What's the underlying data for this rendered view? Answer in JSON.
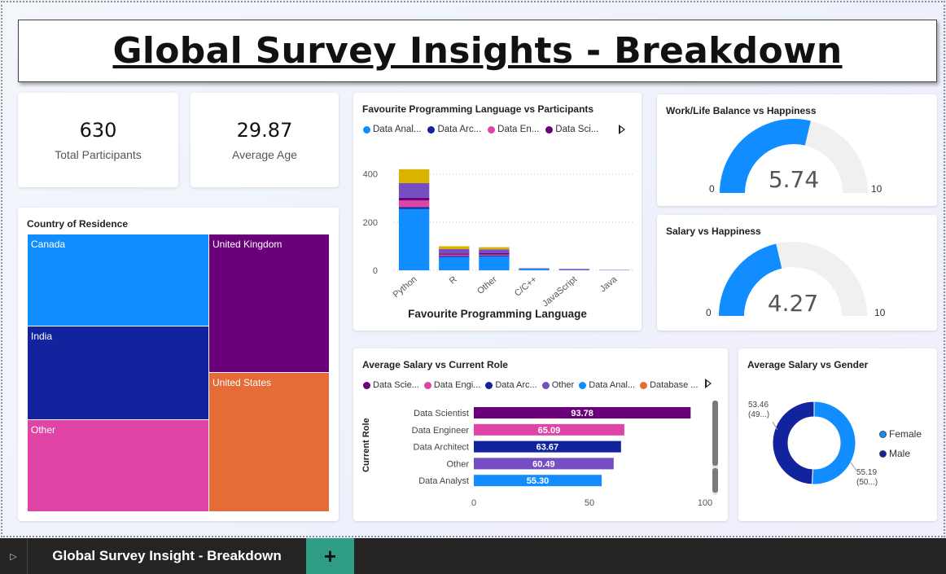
{
  "page": {
    "title": "Global Survey Insights - Breakdown"
  },
  "kpis": {
    "participants": {
      "value": "630",
      "label": "Total Participants"
    },
    "age": {
      "value": "29.87",
      "label": "Average Age"
    }
  },
  "treemap": {
    "title": "Country of Residence",
    "cells": [
      {
        "label": "Canada",
        "color": "#118dff"
      },
      {
        "label": "United Kingdom",
        "color": "#6b007b"
      },
      {
        "label": "India",
        "color": "#12239e"
      },
      {
        "label": "United States",
        "color": "#e66c37"
      },
      {
        "label": "Other",
        "color": "#e044a7"
      }
    ]
  },
  "lang_chart": {
    "title": "Favourite Programming Language vs Participants",
    "legend": [
      {
        "label": "Data Anal...",
        "color": "#118dff"
      },
      {
        "label": "Data Arc...",
        "color": "#12239e"
      },
      {
        "label": "Data En...",
        "color": "#e044a7"
      },
      {
        "label": "Data Sci...",
        "color": "#6b007b"
      }
    ],
    "xlabel": "Favourite Programming Language"
  },
  "role_chart": {
    "title": "Average Salary vs Current Role",
    "legend": [
      {
        "label": "Data Scie...",
        "color": "#6b007b"
      },
      {
        "label": "Data Engi...",
        "color": "#e044a7"
      },
      {
        "label": "Data Arc...",
        "color": "#12239e"
      },
      {
        "label": "Other",
        "color": "#744ec2"
      },
      {
        "label": "Data Anal...",
        "color": "#118dff"
      },
      {
        "label": "Database ...",
        "color": "#e66c37"
      }
    ],
    "ylabel": "Current Role"
  },
  "gauges": {
    "worklife": {
      "title": "Work/Life Balance vs Happiness",
      "value": 5.74,
      "value_text": "5.74",
      "min": "0",
      "max": "10"
    },
    "salary": {
      "title": "Salary vs Happiness",
      "value": 4.27,
      "value_text": "4.27",
      "min": "0",
      "max": "10"
    }
  },
  "donut": {
    "title": "Average Salary vs Gender",
    "legend": [
      {
        "label": "Female",
        "color": "#118dff"
      },
      {
        "label": "Male",
        "color": "#12239e"
      }
    ],
    "label_male": [
      "53.46",
      "(49...)"
    ],
    "label_female": [
      "55.19",
      "(50...)"
    ]
  },
  "tabs": {
    "active": "Global Survey Insight - Breakdown",
    "add": "+",
    "nav": "▷"
  },
  "chart_data": [
    {
      "type": "bar",
      "stacked": true,
      "categories": [
        "Python",
        "R",
        "Other",
        "C/C++",
        "JavaScript",
        "Java"
      ],
      "series": [
        {
          "name": "Data Anal...",
          "color": "#118dff",
          "values": [
            255,
            55,
            58,
            6,
            2,
            1
          ]
        },
        {
          "name": "Data Arc...",
          "color": "#12239e",
          "values": [
            8,
            5,
            4,
            1,
            1,
            0
          ]
        },
        {
          "name": "Data En...",
          "color": "#e044a7",
          "values": [
            27,
            5,
            4,
            1,
            2,
            0
          ]
        },
        {
          "name": "Data Sci...",
          "color": "#6b007b",
          "values": [
            12,
            5,
            5,
            0,
            0,
            0
          ]
        },
        {
          "color": "#744ec2",
          "values": [
            60,
            18,
            16,
            1,
            1,
            1
          ]
        },
        {
          "color": "#d9b300",
          "values": [
            58,
            12,
            9,
            0,
            0,
            0
          ]
        }
      ],
      "yticks": [
        0,
        200,
        400
      ],
      "ylim": [
        0,
        460
      ],
      "xlabel": "Favourite Programming Language"
    },
    {
      "type": "bar",
      "orientation": "horizontal",
      "categories": [
        "Data Scientist",
        "Data Engineer",
        "Data Architect",
        "Other",
        "Data Analyst"
      ],
      "values": [
        93.78,
        65.09,
        63.67,
        60.49,
        55.3
      ],
      "value_labels": [
        "93.78",
        "65.09",
        "63.67",
        "60.49",
        "55.30"
      ],
      "colors": [
        "#6b007b",
        "#e044a7",
        "#12239e",
        "#744ec2",
        "#118dff"
      ],
      "xticks": [
        0,
        50,
        100
      ],
      "xlim": [
        0,
        100
      ],
      "ylabel": "Current Role"
    },
    {
      "type": "pie",
      "donut": true,
      "labels": [
        "Female",
        "Male"
      ],
      "values": [
        55.19,
        53.46
      ],
      "colors": [
        "#118dff",
        "#12239e"
      ]
    }
  ]
}
